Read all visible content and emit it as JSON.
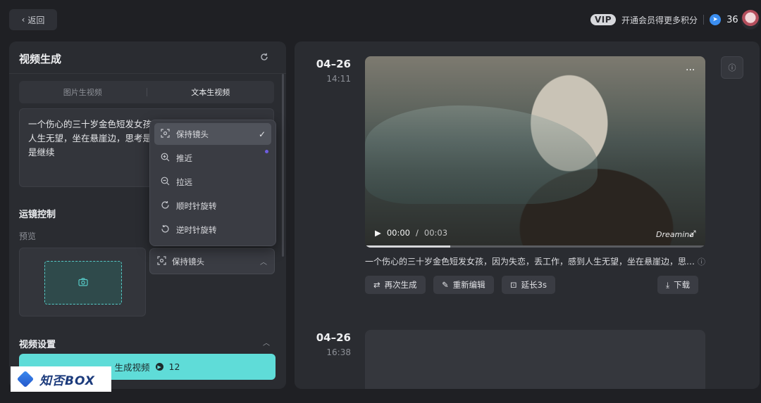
{
  "topbar": {
    "back_label": "返回",
    "vip_badge": "VIP",
    "vip_text": "开通会员得更多积分",
    "credits": "36"
  },
  "left": {
    "title": "视频生成",
    "tabs": [
      "图片生视频",
      "文本生视频"
    ],
    "active_tab": 1,
    "prompt": "一个伤心的三十岁金色短发女孩，因为失恋，丢工作，感到人生无望，坐在悬崖边，思考是否是继续",
    "prompt_visible_lines": [
      "一个伤心的三十岁金色短发女孩",
      "人生无望，坐在悬崖边，思考是",
      "是继续"
    ],
    "camera_title": "运镜控制",
    "preview_label": "预览",
    "camera_select": "保持镜头",
    "video_settings_title": "视频设置",
    "generate_label": "生成视频",
    "generate_cost": "12"
  },
  "dropdown": {
    "items": [
      {
        "label": "保持镜头",
        "icon": "focus-frame-icon",
        "selected": true
      },
      {
        "label": "推近",
        "icon": "zoom-in-icon",
        "selected": false
      },
      {
        "label": "拉远",
        "icon": "zoom-out-icon",
        "selected": false
      },
      {
        "label": "顺时针旋转",
        "icon": "rotate-cw-icon",
        "selected": false
      },
      {
        "label": "逆时针旋转",
        "icon": "rotate-ccw-icon",
        "selected": false
      }
    ]
  },
  "results": [
    {
      "date": "04–26",
      "time": "14:11",
      "player": {
        "current": "00:00",
        "separator": "/",
        "duration": "00:03",
        "brand": "Dreamina",
        "progress": 0.25
      },
      "caption": "一个伤心的三十岁金色短发女孩，因为失恋，丢工作，感到人生无望，坐在悬崖边，思…",
      "actions": [
        "再次生成",
        "重新编辑",
        "延长3s"
      ],
      "download": "下载"
    },
    {
      "date": "04–26",
      "time": "16:38"
    }
  ],
  "watermark": "知否BOX",
  "colors": {
    "accent": "#5fdcd8",
    "credit": "#3b8ef0",
    "bg": "#1f2024",
    "panel": "#2a2c31"
  }
}
